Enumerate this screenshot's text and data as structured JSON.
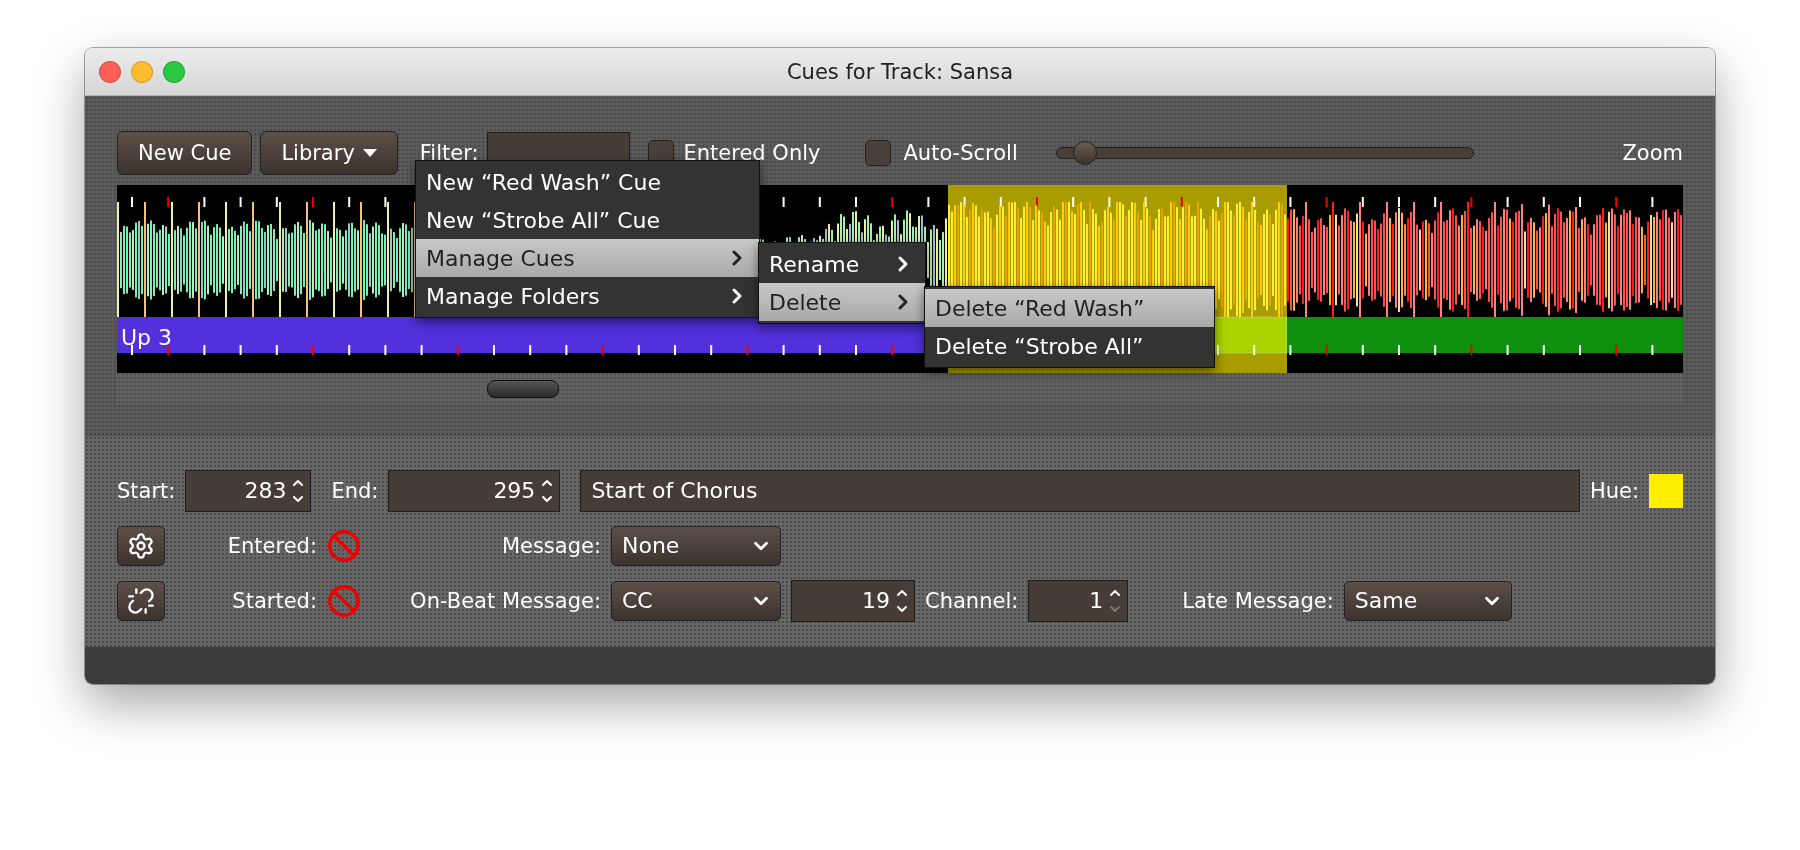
{
  "window": {
    "title": "Cues for Track: Sansa"
  },
  "toolbar": {
    "new_cue": "New Cue",
    "library": "Library",
    "filter": {
      "label": "Filter:"
    },
    "entered_only": {
      "label": "Entered Only",
      "checked": false
    },
    "auto_scroll": {
      "label": "Auto-Scroll",
      "checked": false
    },
    "zoom": {
      "label": "Zoom",
      "level": 0.05
    }
  },
  "waveform": {
    "cues": [
      {
        "label": "Up 3",
        "color": "#5230dc",
        "selected": false
      },
      {
        "color": "#a8d400",
        "selected": true
      },
      {
        "color": "#0e900e",
        "selected": false
      }
    ]
  },
  "library_menu": {
    "items": [
      {
        "label": "New “Red Wash” Cue",
        "kind": "action",
        "selected": false
      },
      {
        "label": "New “Strobe All” Cue",
        "kind": "action",
        "selected": false
      },
      {
        "label": "Manage Cues",
        "kind": "submenu",
        "selected": true
      },
      {
        "label": "Manage Folders",
        "kind": "submenu",
        "selected": false
      }
    ]
  },
  "manage_menu": {
    "items": [
      {
        "label": "Rename",
        "kind": "submenu",
        "selected": false
      },
      {
        "label": "Delete",
        "kind": "submenu",
        "selected": true
      }
    ]
  },
  "delete_menu": {
    "items": [
      {
        "label": "Delete “Red Wash”",
        "selected": true
      },
      {
        "label": "Delete “Strobe All”",
        "selected": false
      }
    ]
  },
  "cue": {
    "start": {
      "label": "Start:",
      "value": "283",
      "decrement_disabled": false
    },
    "end": {
      "label": "End:",
      "value": "295",
      "decrement_disabled": false
    },
    "comment": "Start of Chorus",
    "hue": {
      "label": "Hue:",
      "color": "#ffee00"
    },
    "entered": {
      "label": "Entered:",
      "active": false
    },
    "message": {
      "label": "Message:",
      "value": "None"
    },
    "started": {
      "label": "Started:",
      "active": false
    },
    "on_beat": {
      "label": "On-Beat Message:",
      "value": "CC"
    },
    "note": {
      "value": "19",
      "decrement_disabled": false
    },
    "channel": {
      "label": "Channel:",
      "value": "1",
      "decrement_disabled": true
    },
    "late": {
      "label": "Late Message:",
      "value": "Same"
    }
  }
}
